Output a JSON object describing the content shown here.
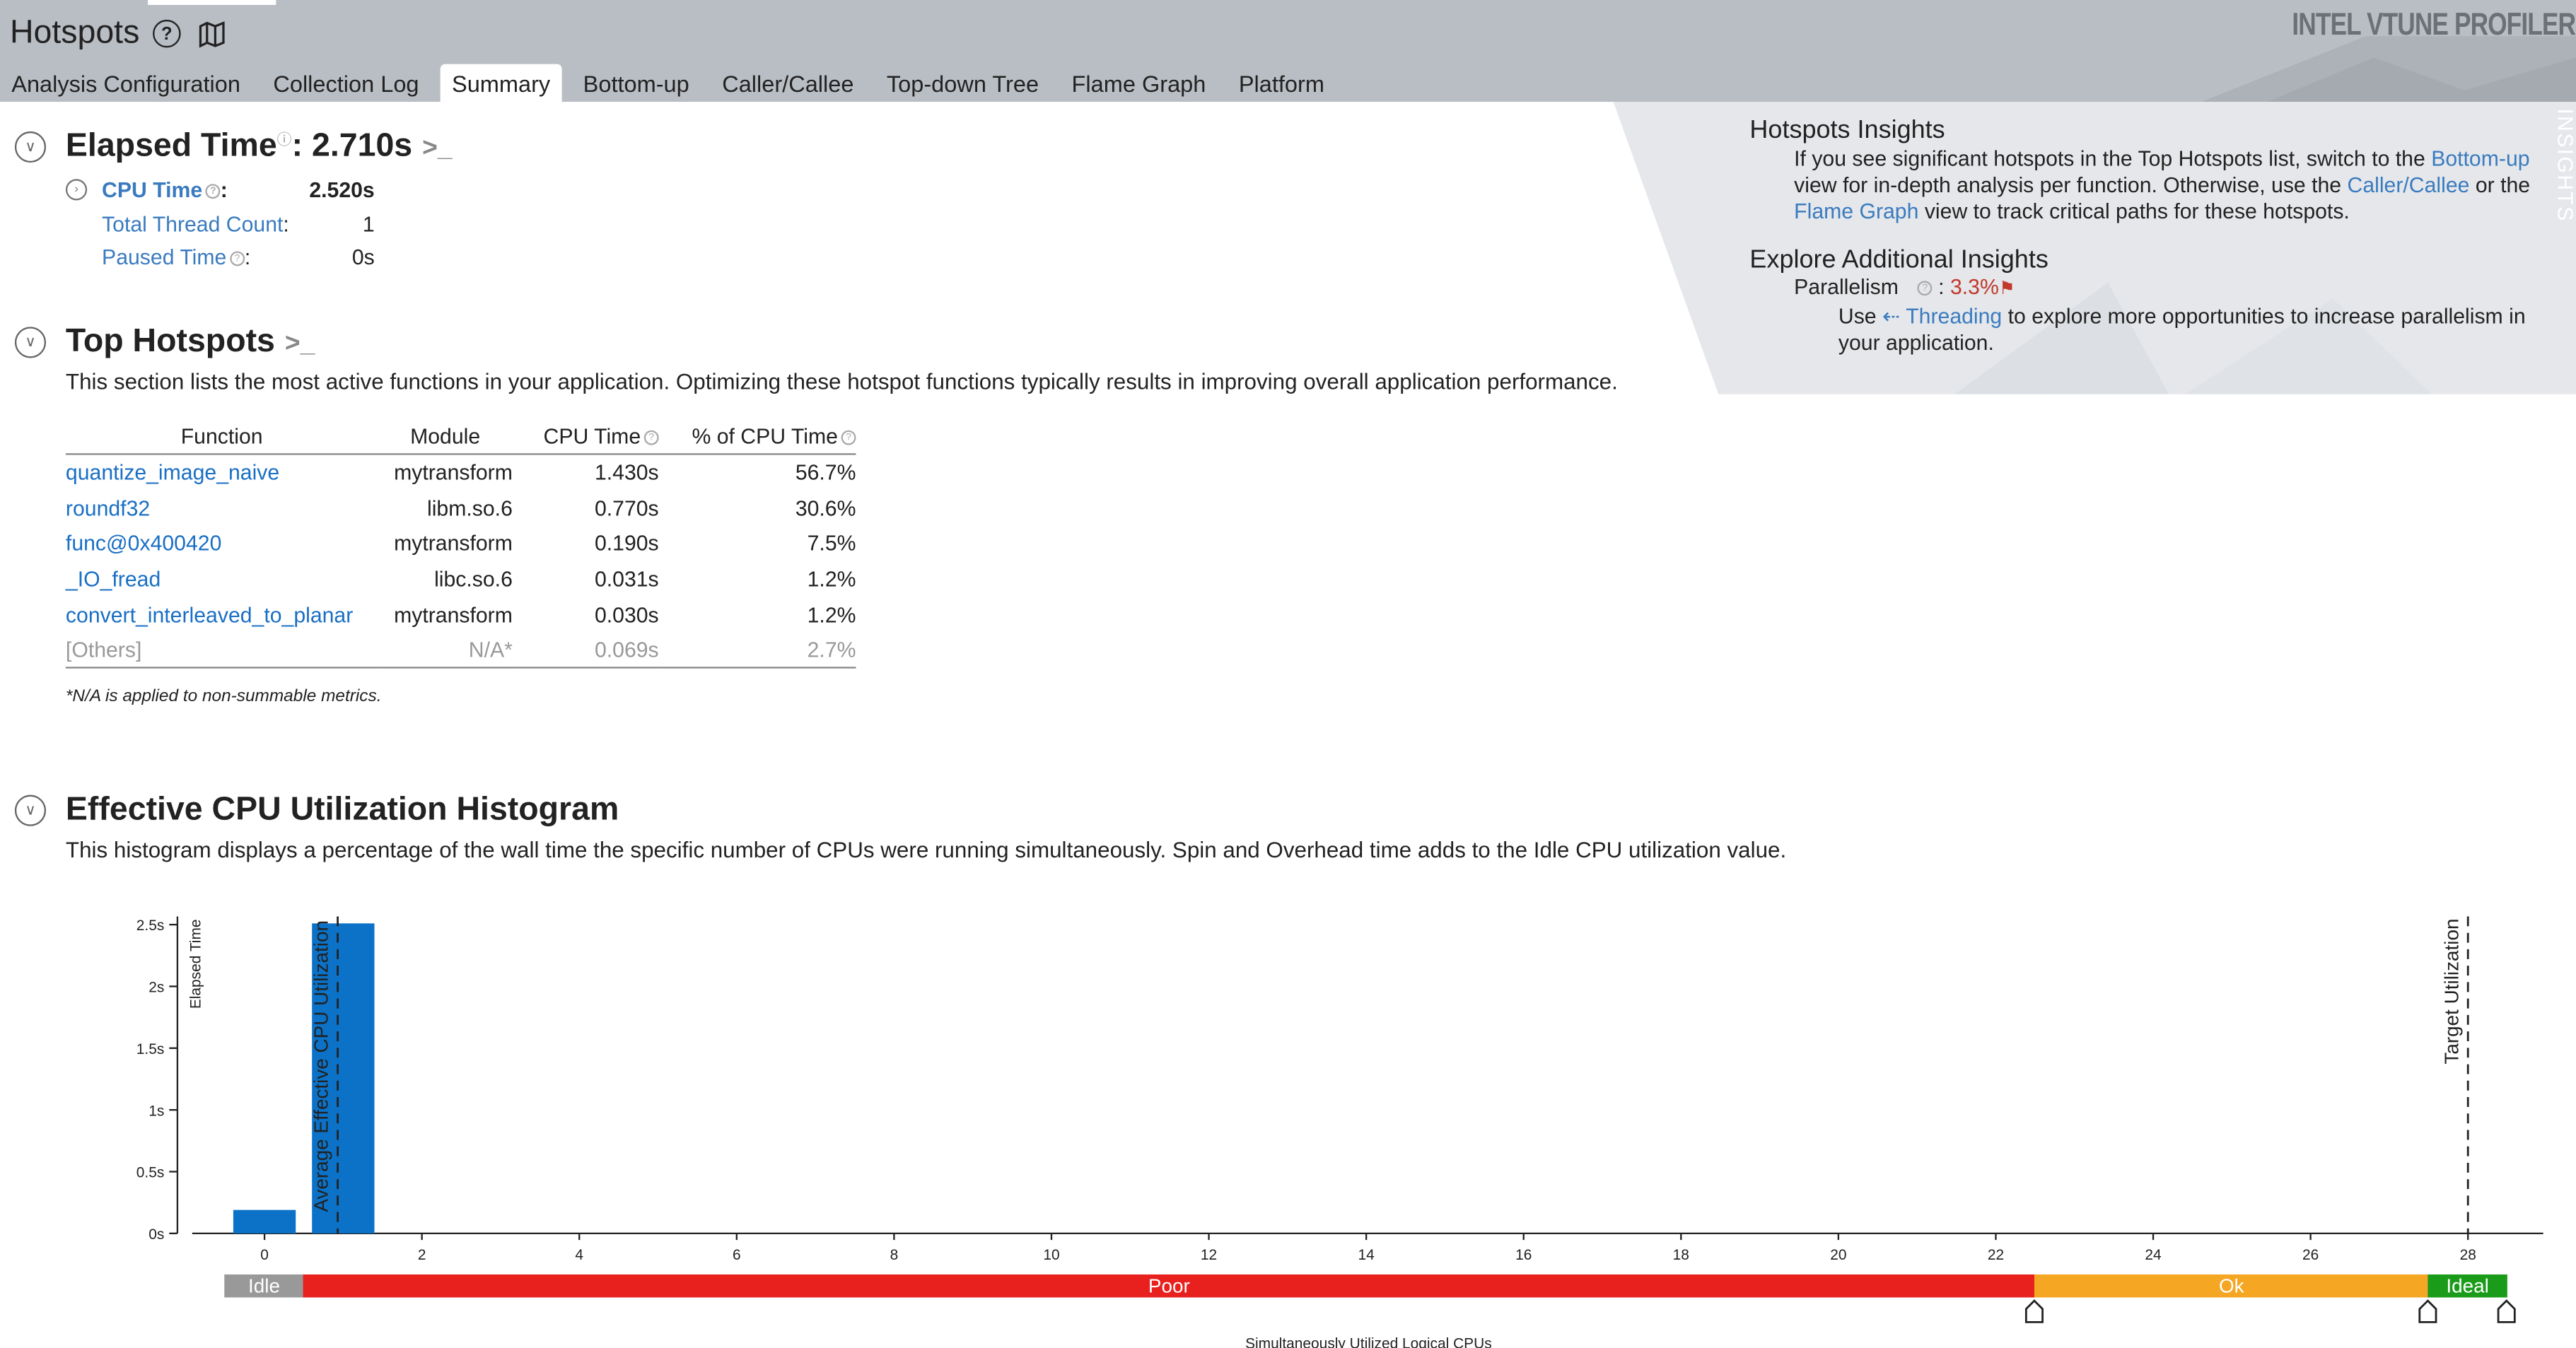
{
  "header": {
    "title": "Hotspots",
    "brand": "INTEL VTUNE PROFILER",
    "tabs": [
      {
        "label": "Analysis Configuration"
      },
      {
        "label": "Collection Log"
      },
      {
        "label": "Summary",
        "active": true
      },
      {
        "label": "Bottom-up"
      },
      {
        "label": "Caller/Callee"
      },
      {
        "label": "Top-down Tree"
      },
      {
        "label": "Flame Graph"
      },
      {
        "label": "Platform"
      }
    ]
  },
  "elapsed": {
    "heading": "Elapsed Time",
    "value": ": 2.710s",
    "cpu_time_label": "CPU Time",
    "cpu_time_value": "2.520s",
    "thread_count_label": "Total Thread Count",
    "thread_count_value": "1",
    "paused_label": "Paused Time",
    "paused_value": "0s"
  },
  "hotspots": {
    "heading": "Top Hotspots",
    "description": "This section lists the most active functions in your application. Optimizing these hotspot functions typically results in improving overall application performance.",
    "columns": [
      "Function",
      "Module",
      "CPU Time",
      "% of CPU Time"
    ],
    "rows": [
      {
        "function": "quantize_image_naive",
        "module": "mytransform",
        "cpu": "1.430s",
        "pct": "56.7%"
      },
      {
        "function": "roundf32",
        "module": "libm.so.6",
        "cpu": "0.770s",
        "pct": "30.6%"
      },
      {
        "function": "func@0x400420",
        "module": "mytransform",
        "cpu": "0.190s",
        "pct": "7.5%"
      },
      {
        "function": "_IO_fread",
        "module": "libc.so.6",
        "cpu": "0.031s",
        "pct": "1.2%"
      },
      {
        "function": "convert_interleaved_to_planar",
        "module": "mytransform",
        "cpu": "0.030s",
        "pct": "1.2%"
      },
      {
        "function": "[Others]",
        "module": "N/A*",
        "cpu": "0.069s",
        "pct": "2.7%"
      }
    ],
    "note": "*N/A is applied to non-summable metrics."
  },
  "insights": {
    "title": "Hotspots Insights",
    "text_1": "If you see significant hotspots in the Top Hotspots list, switch to the ",
    "link_bottomup": "Bottom-up",
    "text_2": " view for in-depth analysis per function. Otherwise, use the ",
    "link_caller": "Caller/Callee",
    "text_3": " or the ",
    "link_flame": "Flame Graph",
    "text_4": " view to track critical paths for these hotspots.",
    "explore_title": "Explore Additional Insights",
    "parallelism_label": "Parallelism",
    "parallelism_value": "3.3%",
    "use_text": "Use ",
    "threading_link": "Threading",
    "use_text_2": " to explore more opportunities to increase parallelism in your application.",
    "side_label": "INSIGHTS",
    "colors": {
      "accent_red": "#c0392b",
      "link": "#3a7bbf"
    }
  },
  "histogram": {
    "heading": "Effective CPU Utilization Histogram",
    "description": "This histogram displays a percentage of the wall time the specific number of CPUs were running simultaneously. Spin and Overhead time adds to the Idle CPU utilization value.",
    "avg_label": "Average Effective CPU Utilization",
    "target_label": "Target Utilization",
    "xlabel": "Simultaneously Utilized Logical CPUs",
    "ylabel": "Elapsed Time",
    "zones": [
      "Idle",
      "Poor",
      "Ok",
      "Ideal"
    ]
  },
  "chart_data": {
    "type": "bar",
    "x": [
      0,
      1
    ],
    "values": [
      0.19,
      2.51
    ],
    "xlabel": "Simultaneously Utilized Logical CPUs",
    "ylabel": "Elapsed Time",
    "xlim": [
      -0.5,
      29
    ],
    "ylim": [
      0,
      2.6
    ],
    "yticks": [
      {
        "v": 0,
        "label": "0s"
      },
      {
        "v": 0.5,
        "label": "0.5s"
      },
      {
        "v": 1,
        "label": "1s"
      },
      {
        "v": 1.5,
        "label": "1.5s"
      },
      {
        "v": 2,
        "label": "2s"
      },
      {
        "v": 2.5,
        "label": "2.5s"
      }
    ],
    "xticks": [
      0,
      2,
      4,
      6,
      8,
      10,
      12,
      14,
      16,
      18,
      20,
      22,
      24,
      26,
      28
    ],
    "avg_utilization": 0.93,
    "target_utilization": 28,
    "zones": [
      {
        "label": "Idle",
        "from": -0.5,
        "to": 0.5,
        "color": "#999999"
      },
      {
        "label": "Poor",
        "from": 0.5,
        "to": 22.5,
        "color": "#e8201e"
      },
      {
        "label": "Ok",
        "from": 22.5,
        "to": 27.5,
        "color": "#f5a623"
      },
      {
        "label": "Ideal",
        "from": 27.5,
        "to": 28.5,
        "color": "#1a9b1a"
      }
    ],
    "thresholds": [
      22.5,
      27.5,
      28.5
    ],
    "bar_color": "#0b72c8",
    "grid": false
  }
}
